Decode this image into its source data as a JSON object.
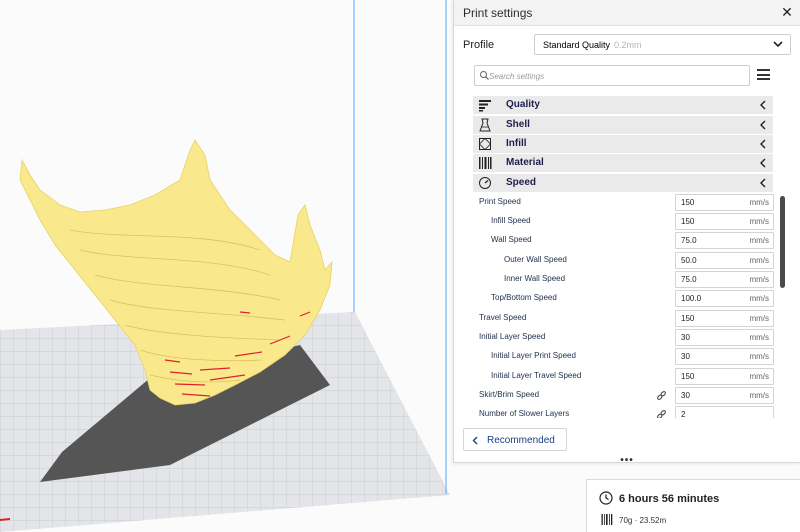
{
  "panel": {
    "title": "Print settings",
    "close_glyph": "✕",
    "profile_label": "Profile",
    "profile_value": "Standard Quality",
    "profile_layer": "0.2mm",
    "search_placeholder": "Search settings"
  },
  "categories": [
    {
      "label": "Quality",
      "icon": "quality-icon"
    },
    {
      "label": "Shell",
      "icon": "shell-icon"
    },
    {
      "label": "Infill",
      "icon": "infill-icon"
    },
    {
      "label": "Material",
      "icon": "material-icon"
    },
    {
      "label": "Speed",
      "icon": "speed-icon"
    }
  ],
  "speed_settings": [
    {
      "label": "Print Speed",
      "value": "150",
      "unit": "mm/s",
      "indent": 0,
      "linked": false
    },
    {
      "label": "Infill Speed",
      "value": "150",
      "unit": "mm/s",
      "indent": 1,
      "linked": false
    },
    {
      "label": "Wall Speed",
      "value": "75.0",
      "unit": "mm/s",
      "indent": 1,
      "linked": false
    },
    {
      "label": "Outer Wall Speed",
      "value": "50.0",
      "unit": "mm/s",
      "indent": 2,
      "linked": false
    },
    {
      "label": "Inner Wall Speed",
      "value": "75.0",
      "unit": "mm/s",
      "indent": 2,
      "linked": false
    },
    {
      "label": "Top/Bottom Speed",
      "value": "100.0",
      "unit": "mm/s",
      "indent": 1,
      "linked": false
    },
    {
      "label": "Travel Speed",
      "value": "150",
      "unit": "mm/s",
      "indent": 0,
      "linked": false
    },
    {
      "label": "Initial Layer Speed",
      "value": "30",
      "unit": "mm/s",
      "indent": 0,
      "linked": false
    },
    {
      "label": "Initial Layer Print Speed",
      "value": "30",
      "unit": "mm/s",
      "indent": 1,
      "linked": false
    },
    {
      "label": "Initial Layer Travel Speed",
      "value": "150",
      "unit": "mm/s",
      "indent": 1,
      "linked": false
    },
    {
      "label": "Skirt/Brim Speed",
      "value": "30",
      "unit": "mm/s",
      "indent": 0,
      "linked": true
    },
    {
      "label": "Number of Slower Layers",
      "value": "2",
      "unit": "",
      "indent": 0,
      "linked": true
    }
  ],
  "footer": {
    "recommended_label": "Recommended",
    "dots": "•••"
  },
  "estimate": {
    "print_time": "6 hours 56 minutes",
    "material": "70g · 23.52m"
  },
  "colors": {
    "model": "#f9e98c",
    "overhang": "#e0202c",
    "shadow": "#555555",
    "grid_line": "#bfc3c8",
    "plate": "#dfe1e4",
    "build_volume": "#4aa8ff",
    "category_text": "#1e1e4c",
    "accent": "#1a3e8c"
  }
}
